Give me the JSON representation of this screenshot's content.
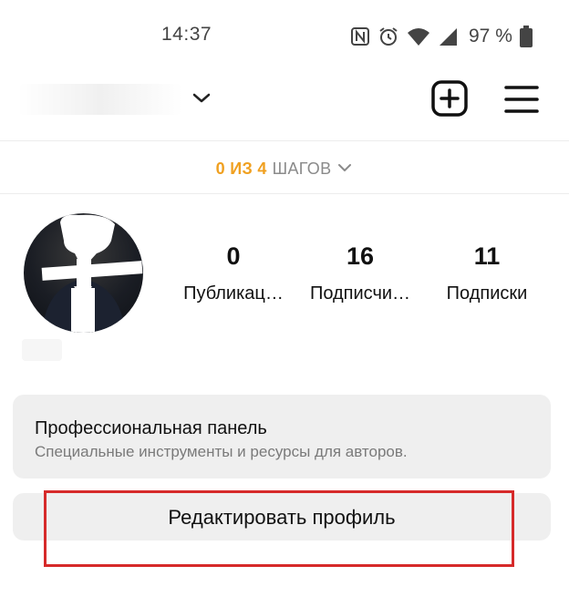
{
  "status_bar": {
    "time": "14:37",
    "battery_percent": "97 %",
    "icons": [
      "nfc-icon",
      "alarm-icon",
      "wifi-icon",
      "signal-icon",
      "battery-icon"
    ]
  },
  "header": {
    "icons": [
      "chevron-down-icon",
      "new-post-icon",
      "menu-icon"
    ]
  },
  "onboarding": {
    "progress": "0 ИЗ 4",
    "label": "ШАГОВ"
  },
  "profile": {
    "stats": [
      {
        "value": "0",
        "label": "Публикац…"
      },
      {
        "value": "16",
        "label": "Подписчи…"
      },
      {
        "value": "11",
        "label": "Подписки"
      }
    ]
  },
  "professional_panel": {
    "title": "Профессиональная панель",
    "subtitle": "Специальные инструменты и ресурсы для авторов."
  },
  "actions": {
    "edit_profile_label": "Редактировать профиль"
  },
  "colors": {
    "accent_orange": "#f0a020",
    "highlight_red": "#d62a2a",
    "panel_gray": "#efefef"
  }
}
